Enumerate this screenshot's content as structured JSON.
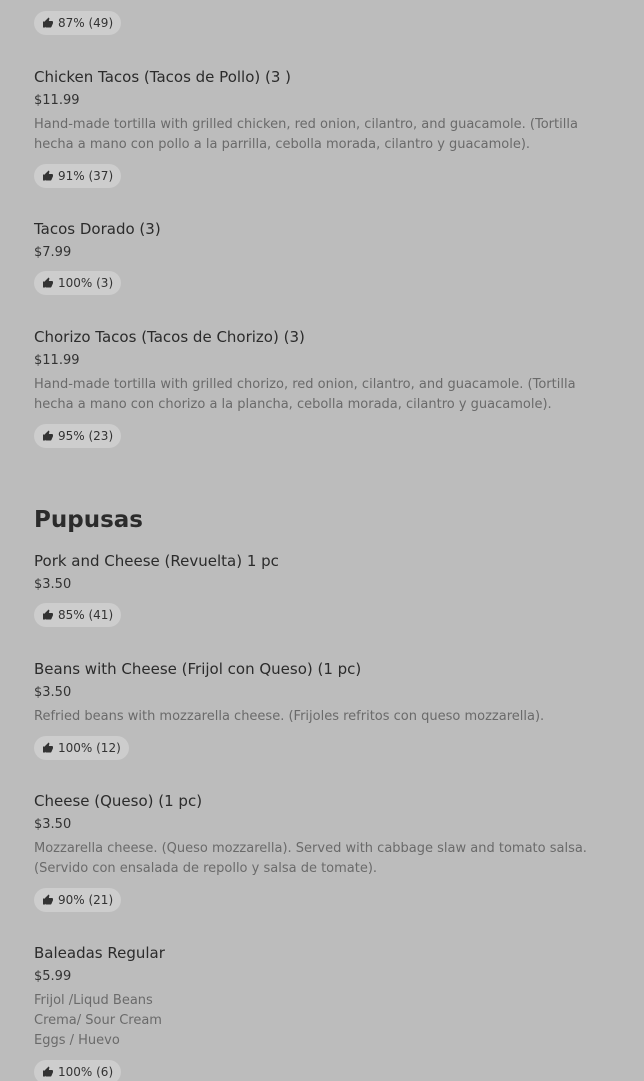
{
  "top_rating": "87% (49)",
  "tacos": [
    {
      "name": "Chicken Tacos (Tacos de Pollo) (3 )",
      "price": "$11.99",
      "desc": "Hand-made tortilla with grilled chicken, red onion, cilantro, and guacamole. (Tortilla hecha a mano con pollo a la parrilla, cebolla morada, cilantro y guacamole).",
      "rating": "91% (37)"
    },
    {
      "name": "Tacos Dorado (3)",
      "price": "$7.99",
      "rating": "100% (3)"
    },
    {
      "name": "Chorizo Tacos (Tacos de Chorizo) (3)",
      "price": "$11.99",
      "desc": "Hand-made tortilla with grilled chorizo, red onion, cilantro, and guacamole. (Tortilla hecha a mano con chorizo a la plancha, cebolla morada, cilantro y guacamole).",
      "rating": "95% (23)"
    }
  ],
  "pupusas_title": "Pupusas",
  "pupusas": [
    {
      "name": "Pork and Cheese (Revuelta) 1 pc",
      "price": "$3.50",
      "rating": "85% (41)"
    },
    {
      "name": "Beans with Cheese (Frijol con Queso) (1 pc)",
      "price": "$3.50",
      "desc": "Refried beans with mozzarella cheese. (Frijoles refritos con queso mozzarella).",
      "rating": "100% (12)"
    },
    {
      "name": "Cheese (Queso) (1 pc)",
      "price": "$3.50",
      "desc": "Mozzarella cheese. (Queso mozzarella). Served with cabbage slaw and tomato salsa. (Servido con ensalada de repollo y salsa de tomate).",
      "rating": "90% (21)"
    },
    {
      "name": "Baleadas Regular",
      "price": "$5.99",
      "desc_lines": [
        "Frijol /Liqud Beans",
        "Crema/ Sour Cream",
        "Eggs / Huevo"
      ],
      "rating": "100% (6)"
    }
  ]
}
